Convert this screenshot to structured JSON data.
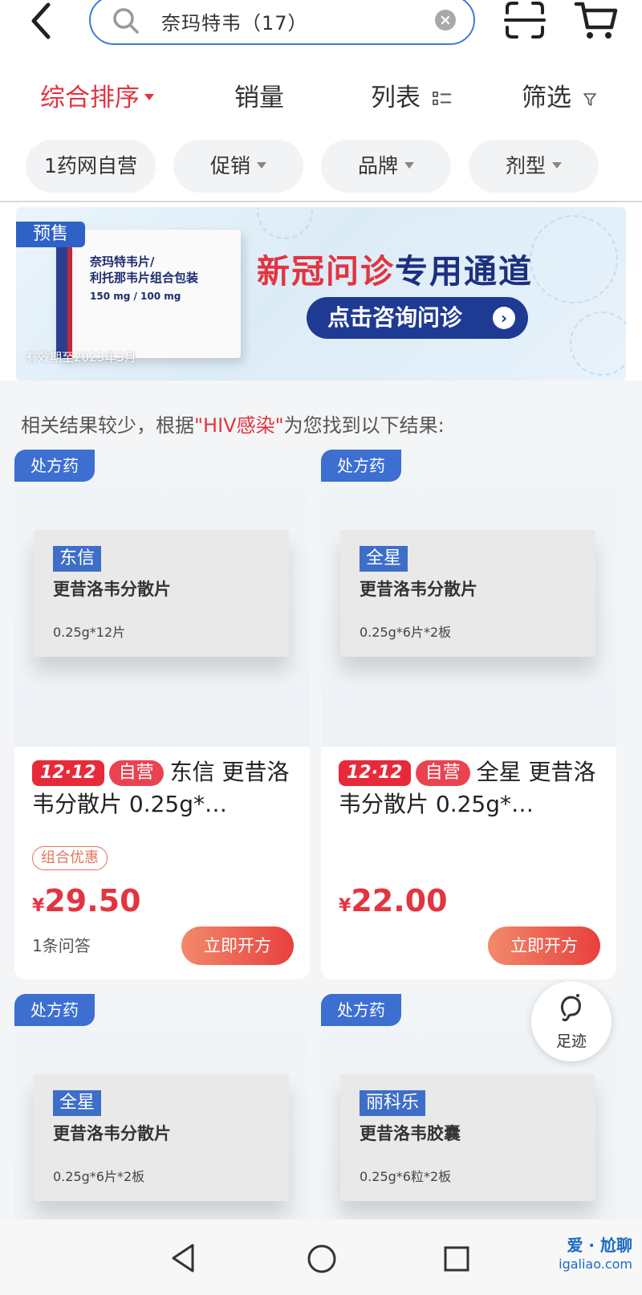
{
  "header": {
    "search_text": "奈玛特韦（17）"
  },
  "sort": {
    "items": [
      "综合排序",
      "销量",
      "列表",
      "筛选"
    ]
  },
  "chips": [
    "1药网自营",
    "促销",
    "品牌",
    "剂型"
  ],
  "banner": {
    "presale": "预售",
    "med_name_1": "奈玛特韦片/",
    "med_name_2": "利托那韦片组合包装",
    "med_dose": "150 mg / 100 mg",
    "expiry": "有效期至2023年3月",
    "title_red": "新冠问诊",
    "title_blue": "专用通道",
    "button": "点击咨询问诊"
  },
  "hint": {
    "prefix": "相关结果较少，根据",
    "keyword": "\"HIV感染\"",
    "suffix": "为您找到以下结果:"
  },
  "products": [
    {
      "rx": "处方药",
      "brand": "东信",
      "pack_name": "更昔洛韦分散片",
      "pack_spec": "0.25g*12片",
      "badge_1212": "12·12",
      "badge_self": "自营",
      "title": "东信 更昔洛韦分散片 0.25g*…",
      "combo": "组合优惠",
      "price_symbol": "¥",
      "price": "29.50",
      "qa": "1条问答",
      "button": "立即开方"
    },
    {
      "rx": "处方药",
      "brand": "全星",
      "pack_name": "更昔洛韦分散片",
      "pack_spec": "0.25g*6片*2板",
      "badge_1212": "12·12",
      "badge_self": "自营",
      "title": "全星 更昔洛韦分散片 0.25g*…",
      "combo": "",
      "price_symbol": "¥",
      "price": "22.00",
      "qa": "",
      "button": "立即开方"
    },
    {
      "rx": "处方药",
      "brand": "全星",
      "pack_name": "更昔洛韦分散片",
      "pack_spec": "0.25g*6片*2板"
    },
    {
      "rx": "处方药",
      "brand": "丽科乐",
      "pack_name": "更昔洛韦胶囊",
      "pack_spec": "0.25g*6粒*2板"
    }
  ],
  "footprint": {
    "label": "足迹"
  },
  "watermark": {
    "main": "爱 · 尬聊",
    "sub": "igaliao.com"
  },
  "icons": {
    "back": "back-arrow-icon",
    "search": "search-icon",
    "clear": "clear-icon",
    "scan": "scan-icon",
    "cart": "cart-icon",
    "nav_back": "nav-back-icon",
    "nav_home": "nav-home-icon",
    "nav_recent": "nav-recent-icon"
  },
  "colors": {
    "accent_red": "#e3343f",
    "brand_blue": "#3d6fd1",
    "search_border": "#3d7bd8"
  }
}
